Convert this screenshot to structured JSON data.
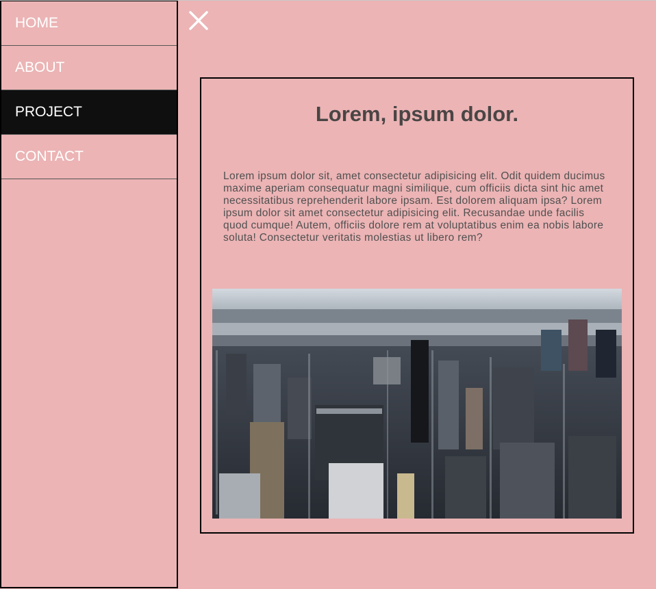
{
  "nav": {
    "items": [
      {
        "label": "HOME",
        "active": false
      },
      {
        "label": "ABOUT",
        "active": false
      },
      {
        "label": "PROJECT",
        "active": true
      },
      {
        "label": "CONTACT",
        "active": false
      }
    ],
    "close_icon": "close-icon"
  },
  "card": {
    "title": "Lorem, ipsum dolor.",
    "body": "Lorem ipsum dolor sit, amet consectetur adipisicing elit. Odit quidem ducimus maxime aperiam consequatur magni similique, cum officiis dicta sint hic amet necessitatibus reprehenderit labore ipsam. Est dolorem aliquam ipsa? Lorem ipsum dolor sit amet consectetur adipisicing elit. Recusandae unde facilis quod cumque! Autem, officiis dolore rem at voluptatibus enim ea nobis labore soluta! Consectetur veritatis molestias ut libero rem?",
    "image": "aerial-city-skyline-photo"
  },
  "colors": {
    "background": "#ecb4b5",
    "active_nav": "#0f0f0f",
    "nav_text": "#ffffff",
    "title_text": "#4a4545",
    "body_text": "#505050"
  }
}
